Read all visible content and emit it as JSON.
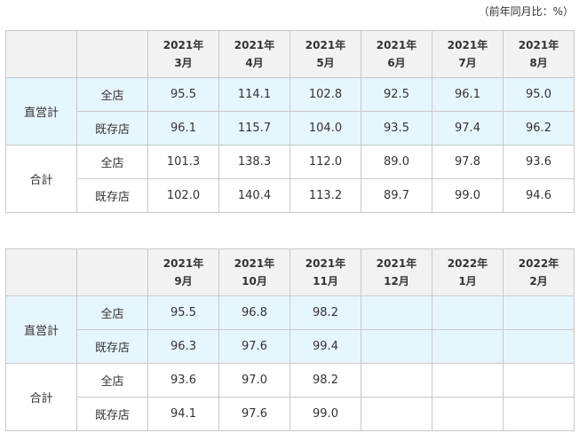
{
  "unit_note": "（前年同月比：%）",
  "tables": [
    {
      "columns": [
        {
          "year": "2021年",
          "month": "3月"
        },
        {
          "year": "2021年",
          "month": "4月"
        },
        {
          "year": "2021年",
          "month": "5月"
        },
        {
          "year": "2021年",
          "month": "6月"
        },
        {
          "year": "2021年",
          "month": "7月"
        },
        {
          "year": "2021年",
          "month": "8月"
        }
      ],
      "groups": [
        {
          "label": "直営計",
          "rows": [
            {
              "label": "全店",
              "values": [
                "95.5",
                "114.1",
                "102.8",
                "92.5",
                "96.1",
                "95.0"
              ]
            },
            {
              "label": "既存店",
              "values": [
                "96.1",
                "115.7",
                "104.0",
                "93.5",
                "97.4",
                "96.2"
              ]
            }
          ]
        },
        {
          "label": "合計",
          "rows": [
            {
              "label": "全店",
              "values": [
                "101.3",
                "138.3",
                "112.0",
                "89.0",
                "97.8",
                "93.6"
              ]
            },
            {
              "label": "既存店",
              "values": [
                "102.0",
                "140.4",
                "113.2",
                "89.7",
                "99.0",
                "94.6"
              ]
            }
          ]
        }
      ]
    },
    {
      "columns": [
        {
          "year": "2021年",
          "month": "9月"
        },
        {
          "year": "2021年",
          "month": "10月"
        },
        {
          "year": "2021年",
          "month": "11月"
        },
        {
          "year": "2021年",
          "month": "12月"
        },
        {
          "year": "2022年",
          "month": "1月"
        },
        {
          "year": "2022年",
          "month": "2月"
        }
      ],
      "groups": [
        {
          "label": "直営計",
          "rows": [
            {
              "label": "全店",
              "values": [
                "95.5",
                "96.8",
                "98.2",
                "",
                "",
                ""
              ]
            },
            {
              "label": "既存店",
              "values": [
                "96.3",
                "97.6",
                "99.4",
                "",
                "",
                ""
              ]
            }
          ]
        },
        {
          "label": "合計",
          "rows": [
            {
              "label": "全店",
              "values": [
                "93.6",
                "97.0",
                "98.2",
                "",
                "",
                ""
              ]
            },
            {
              "label": "既存店",
              "values": [
                "94.1",
                "97.6",
                "99.0",
                "",
                "",
                ""
              ]
            }
          ]
        }
      ]
    }
  ]
}
